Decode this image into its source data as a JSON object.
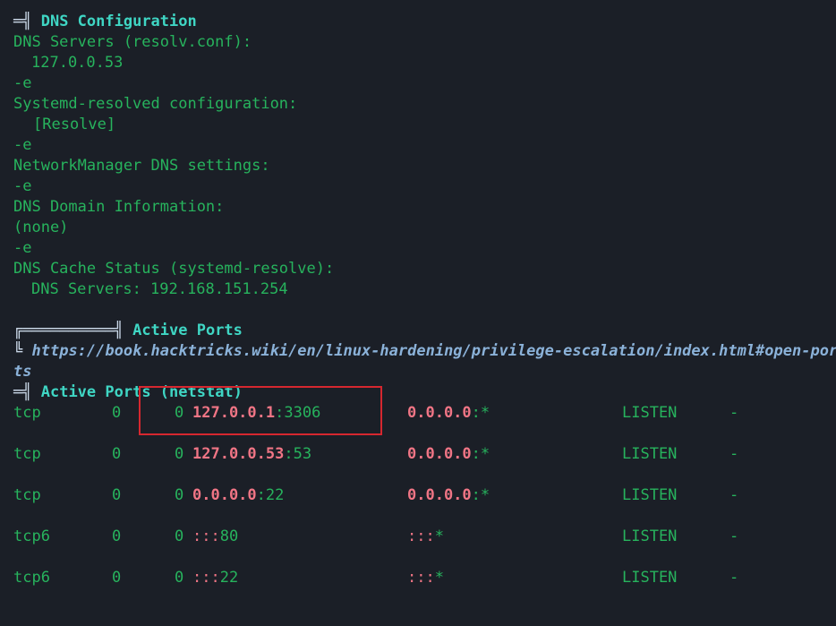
{
  "dns": {
    "heading_glyph": "═╣",
    "heading": "DNS Configuration",
    "servers_label": "DNS Servers (resolv.conf):",
    "servers_value": "127.0.0.53",
    "echo_flag": "-e",
    "systemd_label": "Systemd-resolved configuration:",
    "systemd_value": "[Resolve]",
    "nm_label": "NetworkManager DNS settings:",
    "domain_label": "DNS Domain Information:",
    "domain_value": "(none)",
    "cache_label": "DNS Cache Status (systemd-resolve):",
    "cache_value": "DNS Servers: 192.168.151.254"
  },
  "ports": {
    "banner_glyph": "╔══════════╣",
    "banner_title": "Active Ports",
    "link_prefix": "╚",
    "link_line1": "https://book.hacktricks.wiki/en/linux-hardening/privilege-escalation/index.html#open-por",
    "link_line2": "ts",
    "netstat_glyph": "═╣",
    "netstat_title": "Active Ports (netstat)",
    "rows": [
      {
        "proto": "tcp",
        "recv": "0",
        "send": "0",
        "local_ip": "127.0.0.1",
        "local_port": "3306",
        "foreign_ip": "0.0.0.0",
        "foreign_port": "*",
        "state": "LISTEN",
        "pid": "-"
      },
      {
        "proto": "tcp",
        "recv": "0",
        "send": "0",
        "local_ip": "127.0.0.53",
        "local_port": "53",
        "foreign_ip": "0.0.0.0",
        "foreign_port": "*",
        "state": "LISTEN",
        "pid": "-"
      },
      {
        "proto": "tcp",
        "recv": "0",
        "send": "0",
        "local_ip": "0.0.0.0",
        "local_port": "22",
        "foreign_ip": "0.0.0.0",
        "foreign_port": "*",
        "state": "LISTEN",
        "pid": "-"
      },
      {
        "proto": "tcp6",
        "recv": "0",
        "send": "0",
        "local_ip": ":::",
        "local_port": "80",
        "foreign_ip": ":::",
        "foreign_port": "*",
        "state": "LISTEN",
        "pid": "-"
      },
      {
        "proto": "tcp6",
        "recv": "0",
        "send": "0",
        "local_ip": ":::",
        "local_port": "22",
        "foreign_ip": ":::",
        "foreign_port": "*",
        "state": "LISTEN",
        "pid": "-"
      }
    ]
  },
  "colors": {
    "background": "#1b1f27",
    "text_green": "#27b35d",
    "heading_cyan": "#3fd6c4",
    "ip_red": "#f07585",
    "link_blue": "#8bb2d9",
    "highlight_box": "#d6272f"
  }
}
